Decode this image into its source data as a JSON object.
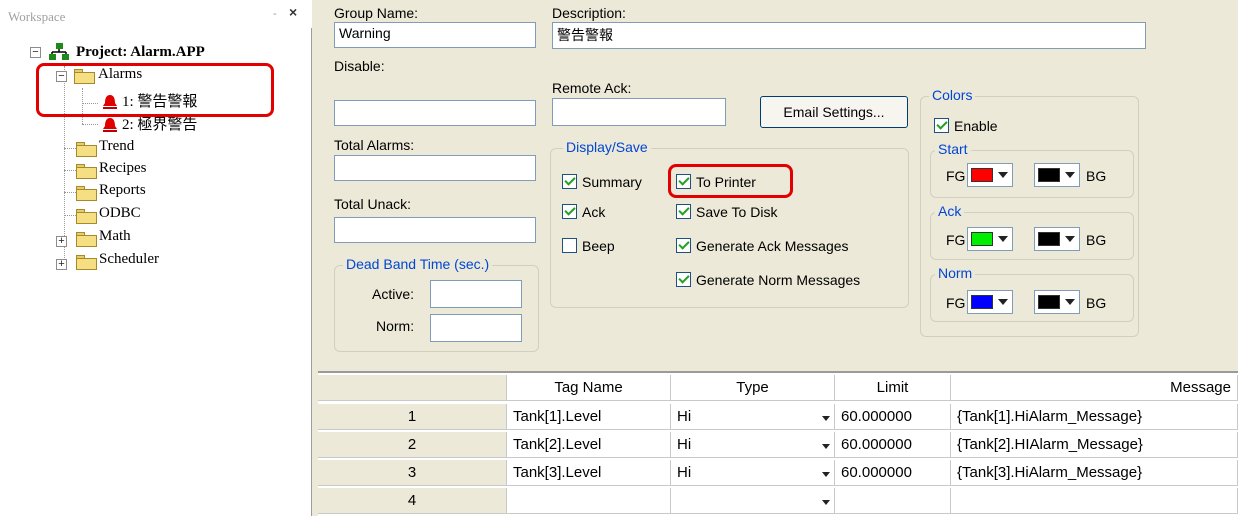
{
  "workspace": {
    "title": "Workspace",
    "pin": "-",
    "close": "×",
    "project": "Project: Alarm.APP",
    "alarms_folder": "Alarms",
    "alarm_items": [
      "1: 警告警報",
      "2: 極界警告"
    ],
    "folders": [
      "Trend",
      "Recipes",
      "Reports",
      "ODBC",
      "Math",
      "Scheduler"
    ]
  },
  "form": {
    "group_name_label": "Group Name:",
    "group_name_value": "Warning",
    "description_label": "Description:",
    "description_value": "警告警報",
    "disable_label": "Disable:",
    "remote_ack_label": "Remote Ack:",
    "email_button": "Email Settings...",
    "total_alarms_label": "Total Alarms:",
    "total_unack_label": "Total Unack:",
    "display_save": {
      "title": "Display/Save",
      "summary": "Summary",
      "ack": "Ack",
      "beep": "Beep",
      "to_printer": "To Printer",
      "save_to_disk": "Save To Disk",
      "gen_ack": "Generate Ack Messages",
      "gen_norm": "Generate Norm Messages"
    },
    "dead_band": {
      "title": "Dead Band Time (sec.)",
      "active": "Active:",
      "norm": "Norm:"
    },
    "colors": {
      "title": "Colors",
      "enable": "Enable",
      "start": "Start",
      "ack": "Ack",
      "norm": "Norm",
      "fg": "FG",
      "bg": "BG",
      "start_fg": "#ff0000",
      "ack_fg": "#00ee00",
      "norm_fg": "#0000ff",
      "bg_color": "#000000"
    }
  },
  "grid": {
    "headers": [
      "Tag Name",
      "Type",
      "Limit",
      "Message"
    ],
    "rows": [
      {
        "num": "1",
        "tag": "Tank[1].Level",
        "type": "Hi",
        "limit": "60.000000",
        "message": "{Tank[1].HiAlarm_Message}"
      },
      {
        "num": "2",
        "tag": "Tank[2].Level",
        "type": "Hi",
        "limit": "60.000000",
        "message": "{Tank[2].HIAlarm_Message}"
      },
      {
        "num": "3",
        "tag": "Tank[3].Level",
        "type": "Hi",
        "limit": "60.000000",
        "message": "{Tank[3].HiAlarm_Message}"
      },
      {
        "num": "4",
        "tag": "",
        "type": "",
        "limit": "",
        "message": ""
      }
    ]
  }
}
